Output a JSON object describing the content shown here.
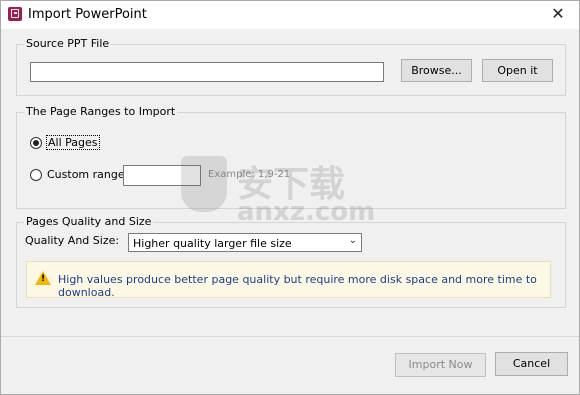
{
  "window": {
    "title": "Import PowerPoint",
    "close_glyph": "✕"
  },
  "source_group": {
    "title": "Source PPT File",
    "file_value": "",
    "browse_label": "Browse...",
    "open_label": "Open it"
  },
  "ranges_group": {
    "title": "The Page Ranges to Import",
    "all_pages_label": "All Pages",
    "custom_label": "Custom range:",
    "custom_value": "",
    "example_text": "Example: 1,9-21"
  },
  "quality_group": {
    "title": "Pages Quality and Size",
    "quality_label": "Quality And Size:",
    "quality_selected": "Higher quality larger file size",
    "warning_text": "High values produce better page quality but require more disk space and more time to download."
  },
  "footer": {
    "import_label": "Import Now",
    "cancel_label": "Cancel"
  },
  "watermark": {
    "line1": "安下载",
    "line2": "anxz.com"
  },
  "colors": {
    "warn_bg": "#fdf8e5",
    "warn_text": "#1a3f8a",
    "accent": "#0078d7"
  }
}
